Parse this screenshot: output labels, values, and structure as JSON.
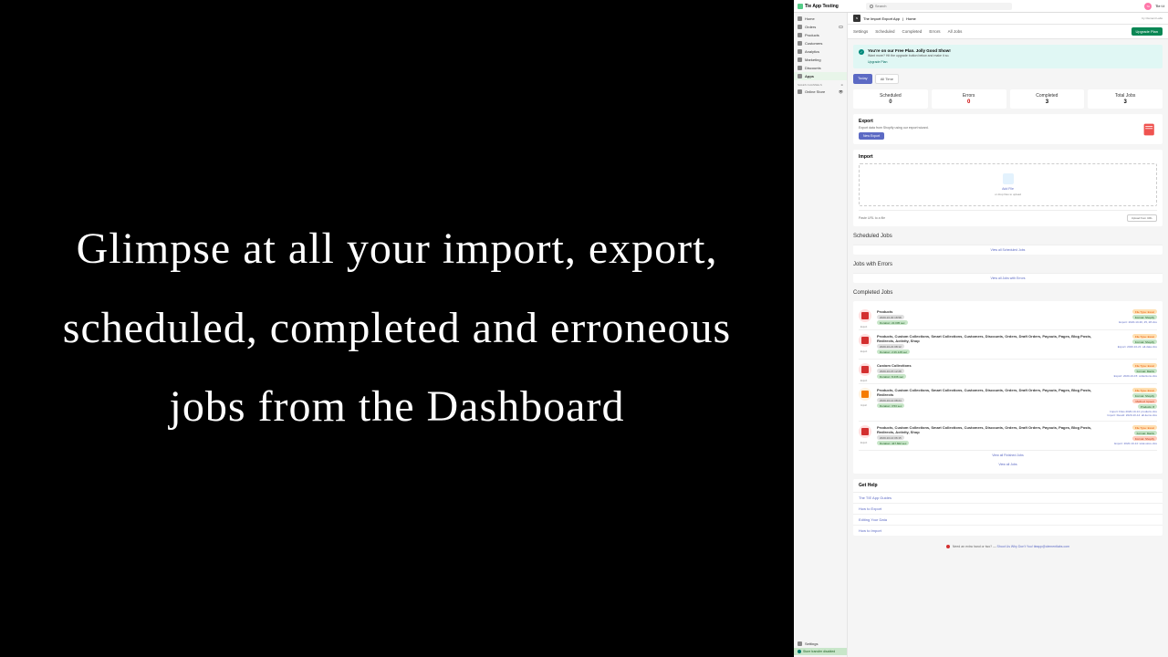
{
  "hero": "Glimpse at all your import, export, scheduled, completed and erroneous jobs from the Dashboard",
  "topbar": {
    "brand": "Tie App Testing",
    "search_placeholder": "Search",
    "avatar_initials": "TA",
    "user_label": "Tie t.t"
  },
  "sidebar": {
    "items": [
      {
        "label": "Home",
        "active": false
      },
      {
        "label": "Orders",
        "active": false
      },
      {
        "label": "Products",
        "active": false
      },
      {
        "label": "Customers",
        "active": false
      },
      {
        "label": "Analytics",
        "active": false
      },
      {
        "label": "Marketing",
        "active": false
      },
      {
        "label": "Discounts",
        "active": false
      },
      {
        "label": "Apps",
        "active": true
      }
    ],
    "channels_label": "Sales Channels",
    "channels": [
      {
        "label": "Online Store"
      }
    ],
    "settings_label": "Settings",
    "transfer_label": "Store transfer disabled"
  },
  "breadcrumb": {
    "app_name": "The Import Export App",
    "page": "Home",
    "author": "by Clement Labs"
  },
  "tabs": {
    "items": [
      "Settings",
      "Scheduled",
      "Completed",
      "Errors",
      "All Jobs"
    ],
    "upgrade_label": "Upgrade Plan"
  },
  "alert": {
    "title": "You're on our Free Plan. Jolly Good Show!",
    "text": "Want more? Hit the upgrade button below and make it so.",
    "link": "Upgrade Plan"
  },
  "time_filter": {
    "today": "Today",
    "all": "All Time"
  },
  "stats": [
    {
      "label": "Scheduled",
      "value": "0",
      "cls": "zero"
    },
    {
      "label": "Errors",
      "value": "0",
      "cls": "error"
    },
    {
      "label": "Completed",
      "value": "3",
      "cls": ""
    },
    {
      "label": "Total Jobs",
      "value": "3",
      "cls": ""
    }
  ],
  "export": {
    "title": "Export",
    "sub": "Export data from Shopify using our export wizard.",
    "btn": "New Export"
  },
  "import": {
    "title": "Import",
    "add": "Add File",
    "hint": "or drop files to upload",
    "url_placeholder": "Paste URL to a file",
    "url_btn": "Upload from URL"
  },
  "sections": {
    "scheduled_title": "Scheduled Jobs",
    "scheduled_link": "View all Scheduled Jobs",
    "errors_title": "Jobs with Errors",
    "errors_link": "View all Jobs with Errors",
    "completed_title": "Completed Jobs",
    "completed_link": "View all Finished Jobs",
    "all_link": "View all Jobs"
  },
  "jobs": [
    {
      "type": "Export",
      "icon": "export",
      "title": "Products",
      "date": "2020-10-30 18:58",
      "duration": "Duration: 22.005 sec",
      "ftype": "File Type: Excel",
      "fmt": "Format: Shopify",
      "link": "Export: 2020-10-30, 25, 28.xlsx"
    },
    {
      "type": "Export",
      "icon": "export",
      "title": "Products, Custom Collections, Smart Collections, Customers, Discounts, Orders, Draft Orders, Payouts, Pages, Blog Posts, Redirects, Activity, Shop",
      "date": "2020-10-21 08:12",
      "duration": "Duration: 2:26.128 sec",
      "ftype": "File Type: Excel",
      "fmt": "Format: Shopify",
      "link": "Export: 2020-10-21: all-data.xlsx"
    },
    {
      "type": "Export",
      "icon": "export",
      "title": "Custom Collections",
      "date": "2020-10-15 12:28",
      "duration": "Duration: 8.236 sec",
      "ftype": "File Type: Excel",
      "fmt": "Format: Matrix",
      "link": "Export: 2020-10-15: collections.xlsx"
    },
    {
      "type": "Import",
      "icon": "import",
      "title": "Products, Custom Collections, Smart Collections, Customers, Discounts, Orders, Draft Orders, Payouts, Pages, Blog Posts, Redirects",
      "date": "2020-10-14 08:24",
      "duration": "Duration: 3:53 sec",
      "ftype": "File Type: Excel",
      "fmt": "Format: Shopify",
      "method": "Method: Upsert",
      "prod": "Products: 8",
      "link1": "Import: Files 2020-10-14: products.xlsx",
      "link2": "Import: Result: 2020-10-14: all-items.xlsx"
    },
    {
      "type": "Export",
      "icon": "export",
      "title": "Products, Custom Collections, Smart Collections, Customers, Discounts, Orders, Draft Orders, Payouts, Pages, Blog Posts, Redirects, Activity, Shop",
      "date": "2020-10-14 06:15",
      "duration": "Duration: 447.602 sec",
      "ftype": "File Type: Excel",
      "fmt": "Format: Matrix",
      "method": "Format: Shopify",
      "link": "Export: 2020-10-14: total-store.xlsx"
    }
  ],
  "help": {
    "title": "Get Help",
    "items": [
      "The TIE App Guides",
      "How to Export",
      "Editing Your Data",
      "How to Import"
    ]
  },
  "footer": {
    "text1": "Need an extra hand or two?",
    "text2": "Shoot Us Why Don't You!",
    "email": "tieapp@clementlabs.com"
  }
}
